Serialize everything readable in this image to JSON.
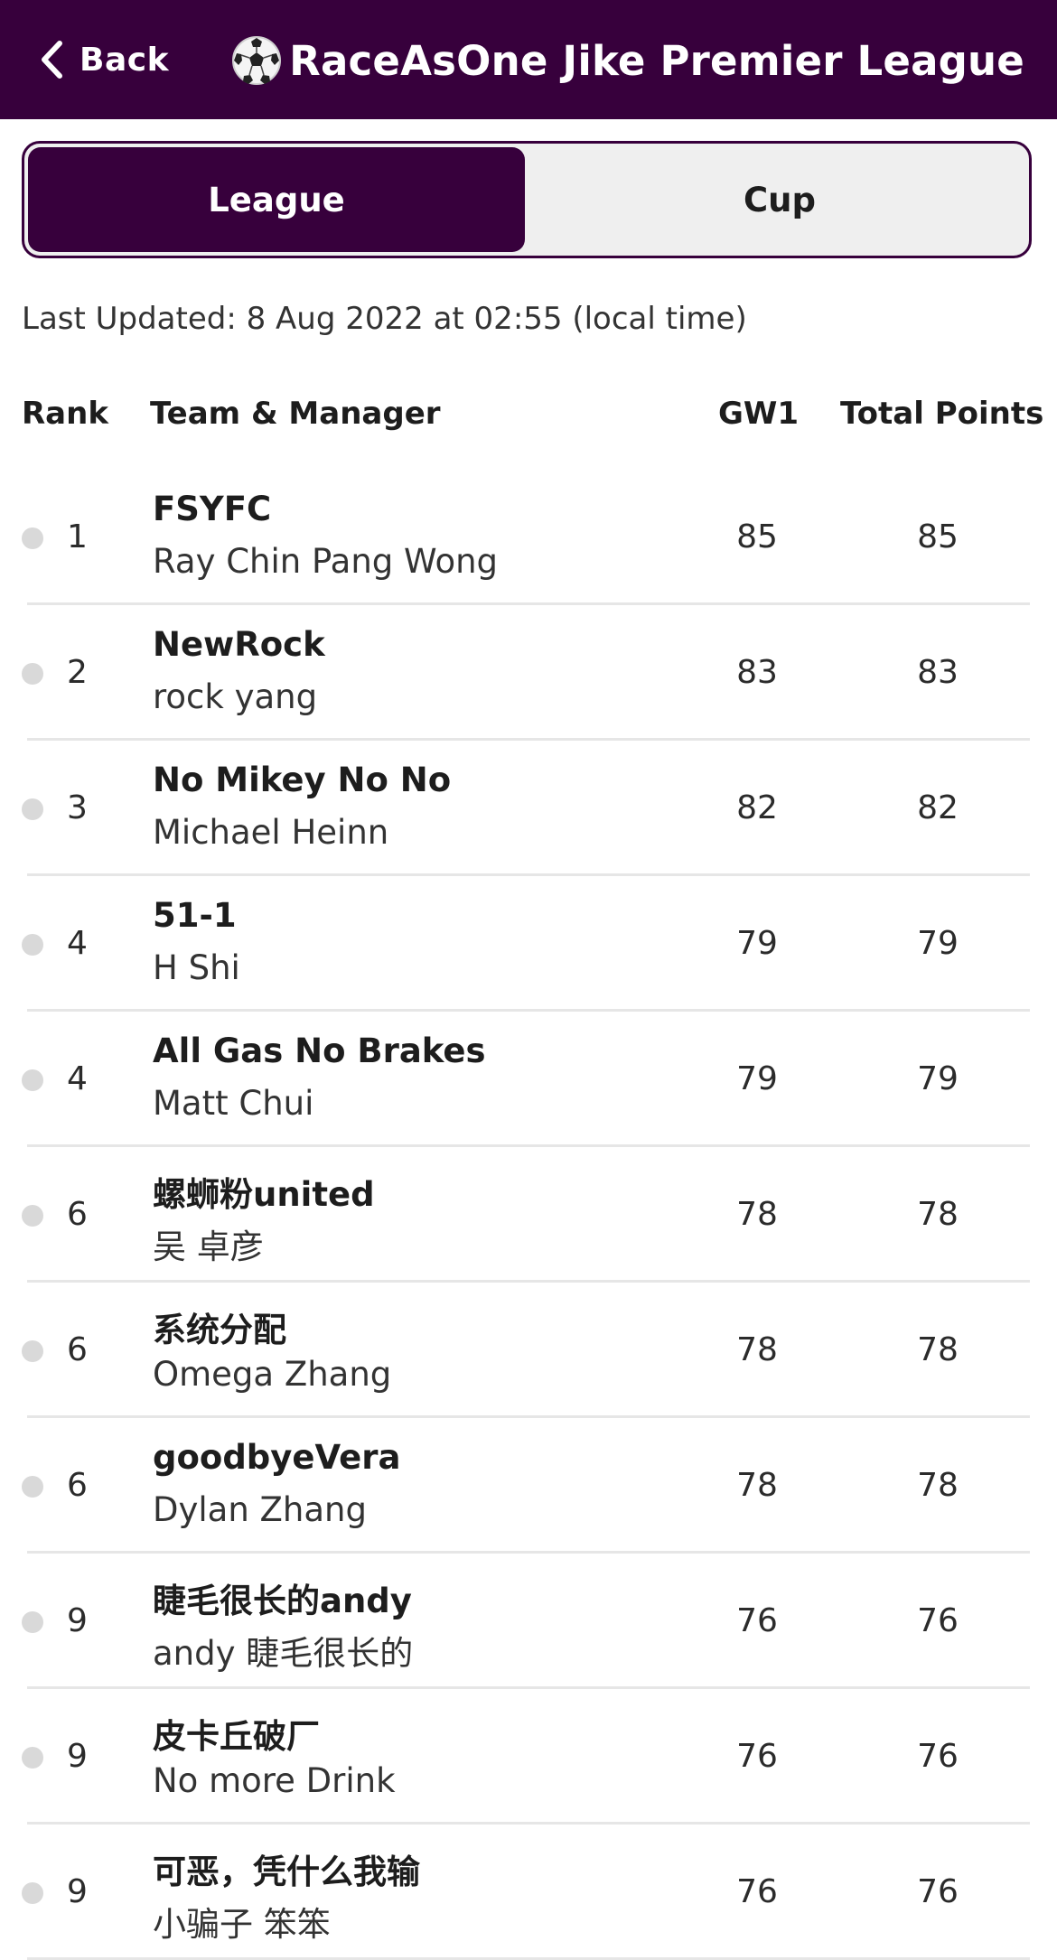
{
  "header": {
    "back_label": "Back",
    "title_emoji": "⚽",
    "title": "RaceAsOne Jike Premier League"
  },
  "tabs": {
    "league_label": "League",
    "cup_label": "Cup",
    "active": "League"
  },
  "last_updated": "Last Updated: 8 Aug 2022 at 02:55 (local time)",
  "columns": {
    "rank": "Rank",
    "team": "Team & Manager",
    "gw": "GW1",
    "total": "Total Points"
  },
  "standings": [
    {
      "rank": "1",
      "team": "FSYFC",
      "manager": "Ray Chin Pang Wong",
      "gw": "85",
      "total": "85"
    },
    {
      "rank": "2",
      "team": "NewRock",
      "manager": "rock yang",
      "gw": "83",
      "total": "83"
    },
    {
      "rank": "3",
      "team": "No Mikey No No",
      "manager": "Michael Heinn",
      "gw": "82",
      "total": "82"
    },
    {
      "rank": "4",
      "team": "51-1",
      "manager": "H Shi",
      "gw": "79",
      "total": "79"
    },
    {
      "rank": "4",
      "team": "All Gas No Brakes",
      "manager": "Matt Chui",
      "gw": "79",
      "total": "79"
    },
    {
      "rank": "6",
      "team": "螺蛳粉united",
      "manager": "吴 卓彦",
      "gw": "78",
      "total": "78"
    },
    {
      "rank": "6",
      "team": "系统分配",
      "manager": "Omega Zhang",
      "gw": "78",
      "total": "78"
    },
    {
      "rank": "6",
      "team": "goodbyeVera",
      "manager": "Dylan Zhang",
      "gw": "78",
      "total": "78"
    },
    {
      "rank": "9",
      "team": "睫毛很长的andy",
      "manager": "andy 睫毛很长的",
      "gw": "76",
      "total": "76"
    },
    {
      "rank": "9",
      "team": "皮卡丘破厂",
      "manager": "No more Drink",
      "gw": "76",
      "total": "76"
    },
    {
      "rank": "9",
      "team": "可恶，凭什么我输",
      "manager": "小骗子 笨笨",
      "gw": "76",
      "total": "76"
    }
  ],
  "colors": {
    "brand": "#37003c",
    "status_dot": "#d9d9d9"
  }
}
